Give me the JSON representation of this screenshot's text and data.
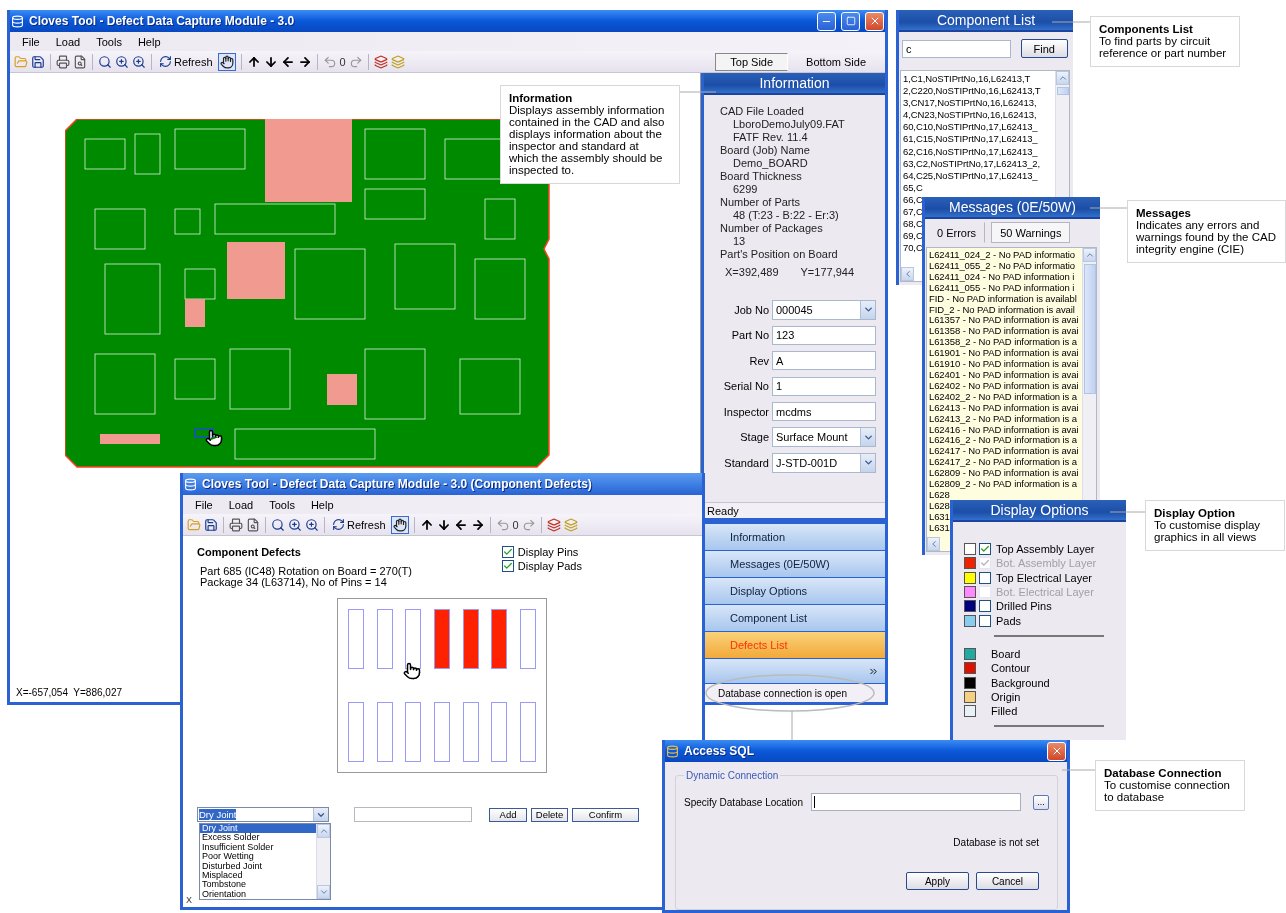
{
  "main_window": {
    "title": "Cloves Tool - Defect Data Capture  Module - 3.0",
    "menu": [
      "File",
      "Load",
      "Tools",
      "Help"
    ],
    "toolbar": {
      "refresh_label": "Refresh",
      "rotation_value": "0",
      "hand_tool_pressed": true
    },
    "side_tabs": [
      {
        "label": "Top Side",
        "selected": true
      },
      {
        "label": "Bottom Side",
        "selected": false
      }
    ],
    "coordinates": "X=-657,054  Y=886,027",
    "info_panel": {
      "title": "Information",
      "details": [
        {
          "label": "CAD File Loaded",
          "values": [
            "LboroDemoJuly09.FAT",
            "FATF Rev. 11.4"
          ]
        },
        {
          "label": "Board (Job) Name",
          "values": [
            "Demo_BOARD"
          ]
        },
        {
          "label": "Board Thickness",
          "values": [
            "6299"
          ]
        },
        {
          "label": "Number of Parts",
          "values": [
            "48 (T:23 - B:22 - Er:3)"
          ]
        },
        {
          "label": "Number of Packages",
          "values": [
            "13"
          ]
        },
        {
          "label": "Part's Position on Board"
        }
      ],
      "position": {
        "x": "X=392,489",
        "y": "Y=177,944"
      },
      "fields": [
        {
          "label": "Job No",
          "value": "000045",
          "kind": "select"
        },
        {
          "label": "Part No",
          "value": "123",
          "kind": "text"
        },
        {
          "label": "Rev",
          "value": "A",
          "kind": "text"
        },
        {
          "label": "Serial No",
          "value": "1",
          "kind": "text"
        },
        {
          "label": "Inspector",
          "value": "mcdms",
          "kind": "text"
        },
        {
          "label": "Stage",
          "value": "Surface Mount",
          "kind": "select"
        },
        {
          "label": "Standard",
          "value": "J-STD-001D",
          "kind": "select"
        }
      ]
    },
    "status": "Ready",
    "nav": [
      {
        "label": "Information",
        "selected": false
      },
      {
        "label": "Messages  (0E/50W)",
        "selected": false
      },
      {
        "label": "Display Options",
        "selected": false
      },
      {
        "label": "Component List",
        "selected": false
      },
      {
        "label": "Defects List",
        "selected": true
      }
    ],
    "connection_status": "Database connection is open"
  },
  "component_list": {
    "title": "Component List",
    "search_value": "c",
    "find_label": "Find",
    "rows": [
      "1,C1,NoSTIPrtNo,16,L62413,T",
      "2,C220,NoSTIPrtNo,16,L62413,T",
      "3,CN17,NoSTIPrtNo,16,L62413,",
      "4,CN23,NoSTIPrtNo,16,L62413,",
      "60,C10,NoSTIPrtNo,17,L62413_",
      "61,C15,NoSTIPrtNo,17,L62413_",
      "62,C16,NoSTIPrtNo,17,L62413_",
      "63,C2,NoSTIPrtNo,17,L62413_2,",
      "64,C25,NoSTIPrtNo,17,L62413_",
      "65,C",
      "66,C",
      "67,C",
      "68,C",
      "69,C",
      "70,C"
    ]
  },
  "messages": {
    "title": "Messages  (0E/50W)",
    "tabs": [
      {
        "label": "0 Errors",
        "selected": false
      },
      {
        "label": "50 Warnings",
        "selected": true
      }
    ],
    "rows": [
      "L62411_024_2 - No PAD informatio",
      "L62411_055_2 - No PAD informatio",
      "L62411_024 - No PAD information i",
      "L62411_055 - No PAD information i",
      "FID - No PAD information is availabl",
      "FID_2 - No PAD information is avail",
      "L61357 - No PAD information is avai",
      "L61358 - No PAD information is avai",
      "L61358_2 - No PAD information is a",
      "L61901 - No PAD information is avai",
      "L61910 - No PAD information is avai",
      "L62401 - No PAD information is avai",
      "L62402 - No PAD information is avai",
      "L62402_2 - No PAD information is a",
      "L62413 - No PAD information is avai",
      "L62413_2 - No PAD information is a",
      "L62416 - No PAD information is avai",
      "L62416_2 - No PAD information is a",
      "L62417 - No PAD information is avai",
      "L62417_2 - No PAD information is a",
      "L62809 - No PAD information is avai",
      "L62809_2 - No PAD information is a",
      "L628",
      "L628",
      "L631",
      "L631"
    ]
  },
  "display_options": {
    "title": "Display Options",
    "layers": [
      {
        "label": "Top Assembly Layer",
        "color": "#ffffff",
        "checked": true,
        "disabled": false
      },
      {
        "label": "Bot. Assembly Layer",
        "color": "#ee2200",
        "checked": true,
        "disabled": true
      },
      {
        "label": "Top Electrical Layer",
        "color": "#ffff00",
        "checked": false,
        "disabled": false
      },
      {
        "label": "Bot. Electrical Layer",
        "color": "#ff88ff",
        "checked": false,
        "disabled": true
      },
      {
        "label": "Drilled Pins",
        "color": "#000080",
        "checked": false,
        "disabled": false
      },
      {
        "label": "Pads",
        "color": "#88ccee",
        "checked": false,
        "disabled": false
      }
    ],
    "colors": [
      {
        "label": "Board",
        "color": "#22aaa0"
      },
      {
        "label": "Contour",
        "color": "#dd1100"
      },
      {
        "label": "Background",
        "color": "#000000"
      },
      {
        "label": "Origin",
        "color": "#f5d080"
      },
      {
        "label": "Filled",
        "color": "#e8f0f8"
      }
    ]
  },
  "defects_window": {
    "title": "Cloves Tool - Defect Data Capture  Module - 3.0   (Component Defects)",
    "menu": [
      "File",
      "Load",
      "Tools",
      "Help"
    ],
    "toolbar": {
      "refresh_label": "Refresh",
      "rotation_value": "0",
      "hand_tool_pressed": true
    },
    "heading": "Component Defects",
    "part_lines": [
      "Part 685 (IC48) Rotation on Board = 270(T)",
      "Package 34 (L63714), No of Pins = 14"
    ],
    "options": [
      {
        "label": "Display Pins",
        "checked": true
      },
      {
        "label": "Display Pads",
        "checked": true
      }
    ],
    "pin_rows": [
      [
        {
          "defect": false
        },
        {
          "defect": false
        },
        {
          "defect": false
        },
        {
          "defect": true
        },
        {
          "defect": true
        },
        {
          "defect": true
        },
        {
          "defect": false
        }
      ],
      [
        {
          "defect": false
        },
        {
          "defect": false
        },
        {
          "defect": false
        },
        {
          "defect": false
        },
        {
          "defect": false
        },
        {
          "defect": false
        },
        {
          "defect": false
        }
      ]
    ],
    "defect_type": "Dry Joint",
    "defect_options": [
      {
        "label": "Dry Joint",
        "selected": true
      },
      {
        "label": "Excess Solder",
        "selected": false
      },
      {
        "label": "Insufficient Solder",
        "selected": false
      },
      {
        "label": "Poor Wetting",
        "selected": false
      },
      {
        "label": "Disturbed Joint",
        "selected": false
      },
      {
        "label": "Misplaced",
        "selected": false
      },
      {
        "label": "Tombstone",
        "selected": false
      },
      {
        "label": "Orientation",
        "selected": false
      }
    ],
    "buttons": [
      "Add",
      "Delete",
      "Confirm"
    ],
    "status": "X"
  },
  "access_sql": {
    "title": "Access SQL",
    "group": "Dynamic Connection",
    "location_label": "Specify Database Location",
    "browse_label": "...",
    "status": "Database is not set",
    "buttons": [
      "Apply",
      "Cancel"
    ]
  },
  "callouts": [
    {
      "title": "Information",
      "text": "Displays assembly information contained in the CAD and also displays information about the inspector and standard at which the assembly should be inspected to."
    },
    {
      "title": "Components List",
      "text": "To find parts by circuit reference or part number"
    },
    {
      "title": "Messages",
      "text": "Indicates any errors and warnings found by the CAD integrity engine (CIE)"
    },
    {
      "title": "Display Option",
      "text": "To customise display graphics in all views"
    },
    {
      "title": "Database Connection",
      "text": "To customise connection to database"
    }
  ]
}
